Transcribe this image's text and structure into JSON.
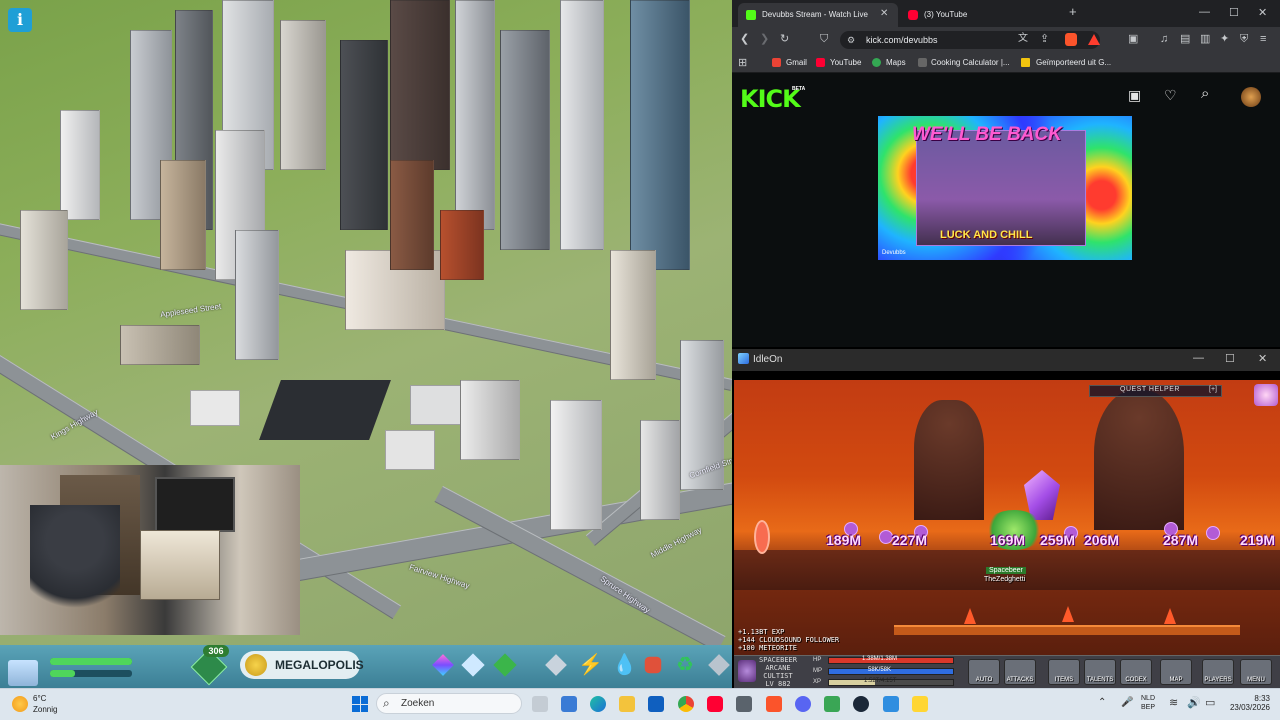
{
  "city_game": {
    "road_labels": [
      "Kings Highway",
      "Fairview Highway",
      "Middle Highway",
      "Spruce Highway",
      "Appleseed Street",
      "Cornfield Street"
    ],
    "population_badge": "306",
    "milestone_label": "MEGALOPOLIS"
  },
  "browser": {
    "tabs": [
      {
        "label": "Devubbs Stream - Watch Live",
        "favicon_color": "#53fc18",
        "active": true
      },
      {
        "label": "(3) YouTube",
        "favicon_color": "#ff0033",
        "active": false
      }
    ],
    "url": "kick.com/devubbs",
    "bookmarks": [
      {
        "label": "Gmail",
        "icon_color": "#ea4335"
      },
      {
        "label": "YouTube",
        "icon_color": "#ff0033"
      },
      {
        "label": "Maps",
        "icon_color": "#34a853"
      },
      {
        "label": "Cooking Calculator |...",
        "icon_color": "#555555"
      },
      {
        "label": "Geïmporteerd uit G...",
        "icon_color": "#f1c40f"
      }
    ],
    "site_logo": "KICK",
    "site_logo_badge": "BETA",
    "offline_banner": {
      "title": "WE'LL BE BACK",
      "tagline": "LUCK AND CHILL",
      "channel_name": "Devubbs"
    }
  },
  "idleon": {
    "window_title": "IdleOn",
    "quest_helper_label": "QUEST HELPER",
    "quest_helper_toggle": "[+]",
    "damage_numbers": [
      "189M",
      "227M",
      "169M",
      "259M",
      "206M",
      "287M",
      "219M"
    ],
    "player_tags": [
      "Spacebeer",
      "TheZedghetti"
    ],
    "chat_log": [
      "+1.13BT EXP",
      "+144 CLOUDSOUND FOLLOWER",
      "+100 METEORITE"
    ],
    "character": {
      "name": "SPACEBEER",
      "class_line1": "ARCANE",
      "class_line2": "CULTIST",
      "level": "LV 882"
    },
    "bars": [
      {
        "label": "HP",
        "value": "1.38M/1.38M",
        "color": "#d9382b",
        "fill": 1.0
      },
      {
        "label": "MP",
        "value": "58K/58K",
        "color": "#2f6de0",
        "fill": 1.0
      },
      {
        "label": "XP",
        "value": "1.52T/4.15T",
        "color": "#d8d0a0",
        "fill": 0.37
      }
    ],
    "hud_buttons": [
      "AUTO",
      "ATTACKS",
      "ITEMS",
      "TALENTS",
      "CODEX",
      "MAP",
      "PLAYERS",
      "MENU"
    ]
  },
  "taskbar": {
    "weather": {
      "temp": "6°C",
      "desc": "Zonnig"
    },
    "search_placeholder": "Zoeken",
    "pinned_icons": [
      "windows-start-icon",
      "search-icon",
      "task-view-icon",
      "store-icon",
      "edge-icon",
      "file-explorer-icon",
      "outlook-icon",
      "chrome-icon",
      "youtube-icon",
      "calculator-icon",
      "brave-icon",
      "discord-icon",
      "gpu-icon",
      "steam-icon",
      "app-icon",
      "notification-app-icon"
    ],
    "tray": {
      "lang_line1": "NLD",
      "lang_line2": "BEP",
      "time": "8:33",
      "date": "23/03/2026"
    }
  }
}
